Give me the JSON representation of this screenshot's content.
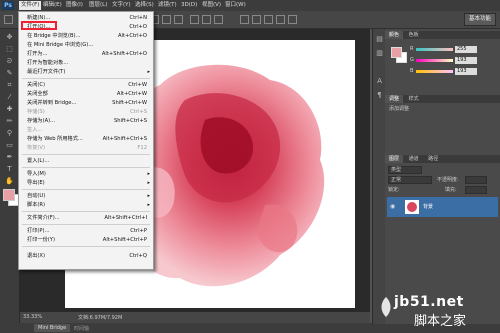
{
  "app": {
    "logo": "Ps"
  },
  "menubar": {
    "file_label": "文件(F)",
    "edit_label": "编辑(E)",
    "image_label": "图像(I)",
    "layer_label": "图层(L)",
    "type_label": "文字(Y)",
    "select_label": "选择(S)",
    "filter_label": "滤镜(T)",
    "view_label": "3D(D)",
    "window_label": "视图(V)",
    "help_label": "窗口(W)"
  },
  "options": {
    "workspace": "基本功能"
  },
  "document": {
    "tab_label": "未标题-1 @ 33.3%",
    "zoom": "33.33%",
    "doc_size": "文档:6.97M/7.92M"
  },
  "bottom": {
    "mini_bridge": "Mini Bridge",
    "timeline": "时间轴"
  },
  "file_menu": {
    "items": [
      {
        "label": "新建(N)...",
        "shortcut": "Ctrl+N"
      },
      {
        "label": "打开(O)...",
        "shortcut": "Ctrl+O"
      },
      {
        "label": "在 Bridge 中浏览(B)...",
        "shortcut": "Alt+Ctrl+O"
      },
      {
        "label": "在 Mini Bridge 中浏览(G)...",
        "shortcut": ""
      },
      {
        "label": "打开为...",
        "shortcut": "Alt+Shift+Ctrl+O"
      },
      {
        "label": "打开为智能对象...",
        "shortcut": ""
      },
      {
        "label": "最近打开文件(T)",
        "shortcut": ""
      },
      {
        "label": "关闭(C)",
        "shortcut": "Ctrl+W"
      },
      {
        "label": "关闭全部",
        "shortcut": "Alt+Ctrl+W"
      },
      {
        "label": "关闭并转到 Bridge...",
        "shortcut": "Shift+Ctrl+W"
      },
      {
        "label": "存储(S)",
        "shortcut": "Ctrl+S"
      },
      {
        "label": "存储为(A)...",
        "shortcut": "Shift+Ctrl+S"
      },
      {
        "label": "签入...",
        "shortcut": ""
      },
      {
        "label": "存储为 Web 所用格式...",
        "shortcut": "Alt+Shift+Ctrl+S"
      },
      {
        "label": "恢复(V)",
        "shortcut": "F12"
      },
      {
        "label": "置入(L)...",
        "shortcut": ""
      },
      {
        "label": "导入(M)",
        "shortcut": ""
      },
      {
        "label": "导出(E)",
        "shortcut": ""
      },
      {
        "label": "自动(U)",
        "shortcut": ""
      },
      {
        "label": "脚本(R)",
        "shortcut": ""
      },
      {
        "label": "文件简介(F)...",
        "shortcut": "Alt+Shift+Ctrl+I"
      },
      {
        "label": "打印(P)...",
        "shortcut": "Ctrl+P"
      },
      {
        "label": "打印一份(Y)",
        "shortcut": "Alt+Shift+Ctrl+P"
      },
      {
        "label": "退出(X)",
        "shortcut": "Ctrl+Q"
      }
    ]
  },
  "color_panel": {
    "tabs": [
      "颜色",
      "色板"
    ],
    "r_label": "R",
    "g_label": "G",
    "b_label": "B",
    "r": "255",
    "g": "193",
    "b": "193",
    "fg_color": "#e6a0a6",
    "bg_color": "#ffffff"
  },
  "adjust_panel": {
    "tabs": [
      "调整",
      "样式"
    ],
    "hint": "添加调整"
  },
  "layers_panel": {
    "tabs": [
      "图层",
      "通道",
      "路径"
    ],
    "kind_label": "类型",
    "blend_mode": "正常",
    "opacity_label": "不透明度:",
    "lock_label": "锁定:",
    "fill_label": "填充:",
    "layer_name": "背景"
  },
  "watermark": {
    "domain": "jb51.net",
    "name": "脚本之家"
  }
}
